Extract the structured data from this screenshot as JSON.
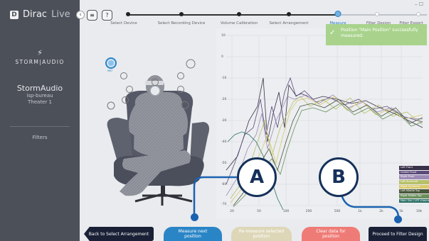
{
  "app": {
    "logo_text": "Dirac",
    "logo_live": "Live",
    "brand": "STORM|AUDIO",
    "device_name": "StormAudio",
    "device_line1": "isp-bureau",
    "device_line2": "Theater 1",
    "filters": "Filters"
  },
  "top": {
    "collapse_icon": "‹",
    "menu_icon": "≡",
    "help_label": "?",
    "window_controls": "– ☐"
  },
  "stepper": {
    "steps": [
      {
        "label": "Select Device",
        "state": "done"
      },
      {
        "label": "Select Recording Device",
        "state": "done"
      },
      {
        "label": "Volume Calibration",
        "state": "done"
      },
      {
        "label": "Select Arrangement",
        "state": "done"
      },
      {
        "label": "Measure",
        "state": "current"
      },
      {
        "label": "Filter Design",
        "state": "future"
      },
      {
        "label": "Filter Export",
        "state": "future"
      }
    ]
  },
  "toast": {
    "line1": "Position \"Main Position\" successfully",
    "line2": "measured."
  },
  "seat": {
    "mic_label": "MKT"
  },
  "graph": {
    "y_ticks": [
      "10",
      "0",
      "-10",
      "-20",
      "-30",
      "-40",
      "-50",
      "-60",
      "-70"
    ],
    "x_ticks": [
      "20",
      "50",
      "100",
      "200",
      "500",
      "1k",
      "2k",
      "5k",
      "10k"
    ]
  },
  "legend": [
    {
      "label": "Left Front",
      "color": "#39304a"
    },
    {
      "label": "Center Front",
      "color": "#5c4a7a"
    },
    {
      "label": "Right Front",
      "color": "#9c8ab5"
    },
    {
      "label": "Left Surround",
      "color": "#b7c069"
    },
    {
      "label": "Right Surround",
      "color": "#d9c96a"
    },
    {
      "label": "Left Middle Top",
      "color": "#49573a"
    },
    {
      "label": "Right Middle Top",
      "color": "#6a8f5c"
    },
    {
      "label": "Main Sub / LFE channel",
      "color": "#2a6f66"
    }
  ],
  "markers": {
    "a": "A",
    "b": "B"
  },
  "buttons": {
    "back": "Back to Select Arrangement",
    "measure_line1": "Measure next",
    "measure_line2": "position",
    "remeasure_line1": "Re-measure selected",
    "remeasure_line2": "position",
    "clear_line1": "Clear data for",
    "clear_line2": "position",
    "proceed": "Proceed to Filter Design"
  },
  "colors": {
    "sidebar": "#4c5059",
    "accent": "#2a85c6",
    "toast": "#a9d38c",
    "marker": "#15305a"
  }
}
